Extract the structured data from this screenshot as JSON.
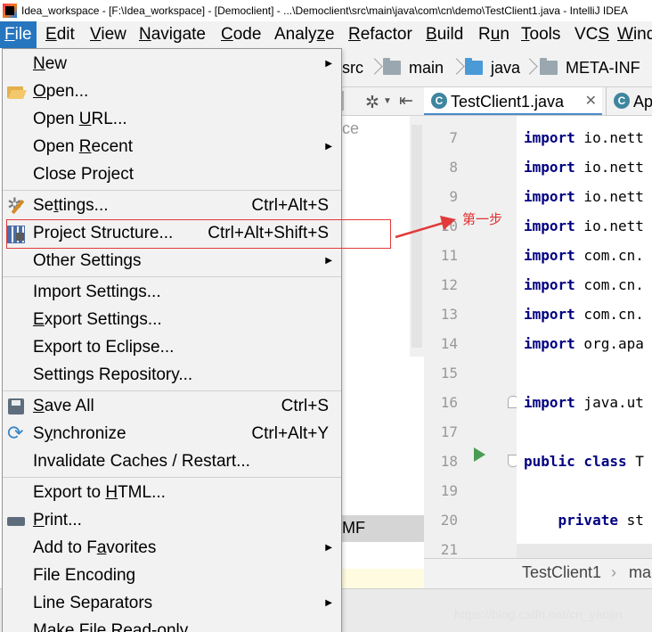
{
  "window": {
    "title": "Idea_workspace - [F:\\Idea_workspace] - [Democlient] - ...\\Democlient\\src\\main\\java\\com\\cn\\demo\\TestClient1.java - IntelliJ IDEA"
  },
  "menubar": {
    "file_mn": "F",
    "file_rest": "ile",
    "edit_mn": "E",
    "edit_rest": "dit",
    "view_mn": "V",
    "view_rest": "iew",
    "navigate_mn": "N",
    "navigate_rest": "avigate",
    "code_mn": "C",
    "code_rest": "ode",
    "analyze_pre": "Analy",
    "analyze_mn": "z",
    "analyze_rest": "e",
    "refactor_mn": "R",
    "refactor_rest": "efactor",
    "build_mn": "B",
    "build_rest": "uild",
    "run_pre": "R",
    "run_mn": "u",
    "run_rest": "n",
    "tools_mn": "T",
    "tools_rest": "ools",
    "vcs_pre": "VC",
    "vcs_mn": "S",
    "vcs_rest": "",
    "window_mn": "W",
    "window_rest": "indow"
  },
  "navbar": {
    "crumbs": [
      "src",
      "main",
      "java",
      "META-INF"
    ],
    "folder_colors": {
      "main": "#9aa7b0",
      "java": "#4a9ad8",
      "meta": "#9aa7b0"
    }
  },
  "project_panel": {
    "fragment_top": "ce",
    "fragment_selected": "MF"
  },
  "editor": {
    "tabs": [
      {
        "label": "TestClient1.java",
        "icon": "C"
      },
      {
        "label": "Ap",
        "icon": "C"
      }
    ],
    "line_numbers": [
      "7",
      "8",
      "9",
      "10",
      "11",
      "12",
      "13",
      "14",
      "15",
      "16",
      "17",
      "18",
      "19",
      "20",
      "21"
    ],
    "lines": [
      {
        "kw": "import",
        "rest": " io.nett"
      },
      {
        "kw": "import",
        "rest": " io.nett"
      },
      {
        "kw": "import",
        "rest": " io.nett"
      },
      {
        "kw": "import",
        "rest": " io.nett"
      },
      {
        "kw": "import",
        "rest": " com.cn."
      },
      {
        "kw": "import",
        "rest": " com.cn."
      },
      {
        "kw": "import",
        "rest": " com.cn."
      },
      {
        "kw": "import",
        "rest": " org.apa"
      },
      {
        "kw": "",
        "rest": ""
      },
      {
        "kw": "import",
        "rest": " java.ut"
      },
      {
        "kw": "",
        "rest": ""
      },
      {
        "kw": "public class",
        "rest": " T"
      },
      {
        "kw": "",
        "rest": ""
      },
      {
        "kw": "    private",
        "rest": " st"
      },
      {
        "kw": "",
        "rest": ""
      }
    ],
    "breadcrumb": [
      "TestClient1",
      "ma"
    ],
    "breadcrumb_sep": "›"
  },
  "file_menu": {
    "items": [
      {
        "pre": "",
        "mn": "N",
        "post": "ew",
        "shortcut": "",
        "submenu": true,
        "icon": ""
      },
      {
        "pre": "",
        "mn": "O",
        "post": "pen...",
        "shortcut": "",
        "submenu": false,
        "icon": "open-icon"
      },
      {
        "pre": "Open ",
        "mn": "U",
        "post": "RL...",
        "shortcut": "",
        "submenu": false,
        "icon": ""
      },
      {
        "pre": "Open ",
        "mn": "R",
        "post": "ecent",
        "shortcut": "",
        "submenu": true,
        "icon": ""
      },
      {
        "pre": "Close Pro",
        "mn": "j",
        "post": "ect",
        "shortcut": "",
        "submenu": false,
        "icon": ""
      },
      {
        "pre": "Se",
        "mn": "t",
        "post": "tings...",
        "shortcut": "Ctrl+Alt+S",
        "submenu": false,
        "icon": "settings-icon"
      },
      {
        "pre": "Project Structure...",
        "mn": "",
        "post": "",
        "shortcut": "Ctrl+Alt+Shift+S",
        "submenu": false,
        "icon": "project-structure-icon"
      },
      {
        "pre": "Other Settings",
        "mn": "",
        "post": "",
        "shortcut": "",
        "submenu": true,
        "icon": ""
      },
      {
        "pre": "Import Settings...",
        "mn": "",
        "post": "",
        "shortcut": "",
        "submenu": false,
        "icon": ""
      },
      {
        "pre": "",
        "mn": "E",
        "post": "xport Settings...",
        "shortcut": "",
        "submenu": false,
        "icon": ""
      },
      {
        "pre": "Export to Eclipse...",
        "mn": "",
        "post": "",
        "shortcut": "",
        "submenu": false,
        "icon": ""
      },
      {
        "pre": "Settings Repository...",
        "mn": "",
        "post": "",
        "shortcut": "",
        "submenu": false,
        "icon": ""
      },
      {
        "pre": "",
        "mn": "S",
        "post": "ave All",
        "shortcut": "Ctrl+S",
        "submenu": false,
        "icon": "save-icon"
      },
      {
        "pre": "S",
        "mn": "y",
        "post": "nchronize",
        "shortcut": "Ctrl+Alt+Y",
        "submenu": false,
        "icon": "sync-icon"
      },
      {
        "pre": "Invalidate Caches / Restart...",
        "mn": "",
        "post": "",
        "shortcut": "",
        "submenu": false,
        "icon": ""
      },
      {
        "pre": "Export to ",
        "mn": "H",
        "post": "TML...",
        "shortcut": "",
        "submenu": false,
        "icon": ""
      },
      {
        "pre": "",
        "mn": "P",
        "post": "rint...",
        "shortcut": "",
        "submenu": false,
        "icon": "print-icon"
      },
      {
        "pre": "Add to F",
        "mn": "a",
        "post": "vorites",
        "shortcut": "",
        "submenu": true,
        "icon": ""
      },
      {
        "pre": "File Encoding",
        "mn": "",
        "post": "",
        "shortcut": "",
        "submenu": false,
        "icon": ""
      },
      {
        "pre": "Line Separators",
        "mn": "",
        "post": "",
        "shortcut": "",
        "submenu": true,
        "icon": ""
      },
      {
        "pre": "Make File Read-only",
        "mn": "",
        "post": "",
        "shortcut": "",
        "submenu": false,
        "icon": ""
      }
    ],
    "submenu_glyph": "▶"
  },
  "annotation": {
    "label": "第一步",
    "color": "#e23a3a"
  },
  "watermark": "https://blog.csdn.net/cn_yaojin"
}
